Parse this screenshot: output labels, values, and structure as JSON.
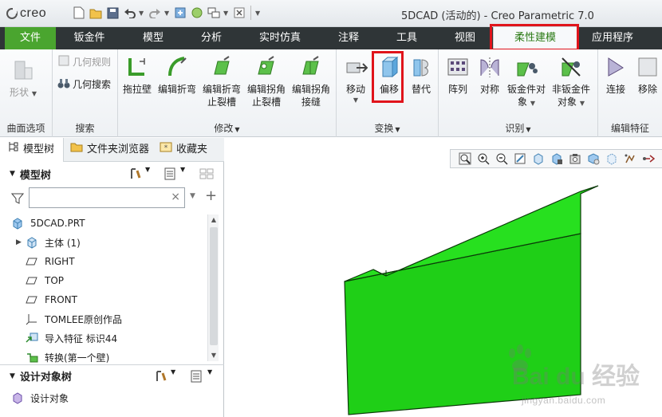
{
  "app": {
    "logo_text": "creo",
    "window_title": "5DCAD (活动的) - Creo Parametric 7.0"
  },
  "quick_access": [
    "new-icon",
    "open-icon",
    "save-icon",
    "undo-icon",
    "redo-icon",
    "regenerate-icon",
    "windows-icon",
    "close-window-icon"
  ],
  "tabs": {
    "file": "文件",
    "sheetmetal": "钣金件",
    "model": "模型",
    "analysis": "分析",
    "simulation": "实时仿真",
    "annotate": "注释",
    "tools": "工具",
    "view": "视图",
    "flexible": "柔性建模",
    "apps": "应用程序"
  },
  "ribbon": {
    "surface": {
      "label": "曲面选项",
      "shape": "形状"
    },
    "search": {
      "label": "搜索",
      "geom_rules": "几何规则",
      "geom_search": "几何搜索"
    },
    "modify": {
      "label": "修改",
      "drag_wall": "拖拉壁",
      "edit_bend": "编辑折弯",
      "edit_bend_relief": [
        "编辑折弯",
        "止裂槽"
      ],
      "edit_corner_relief": [
        "编辑拐角",
        "止裂槽"
      ],
      "edit_corner_seam": [
        "编辑拐角",
        "接缝"
      ]
    },
    "transform": {
      "label": "变换",
      "move": "移动",
      "offset": "偏移",
      "replace": "替代"
    },
    "recognize": {
      "label": "识别",
      "pattern": "阵列",
      "symmetry": "对称",
      "sheetmetal_obj": [
        "钣金件对",
        "象"
      ],
      "non_sheetmetal_obj": [
        "非钣金件",
        "对象"
      ]
    },
    "edit_feature": {
      "label": "编辑特征",
      "attach": "连接",
      "remove": "移除"
    }
  },
  "panel_tabs": {
    "model_tree": "模型树",
    "folder_browser": "文件夹浏览器",
    "favorites": "收藏夹"
  },
  "model_tree": {
    "header": "模型树",
    "search_placeholder": "",
    "items": [
      {
        "label": "5DCAD.PRT",
        "icon": "part-icon"
      },
      {
        "label": "主体 (1)",
        "icon": "body-icon"
      },
      {
        "label": "RIGHT",
        "icon": "datum-plane-icon"
      },
      {
        "label": "TOP",
        "icon": "datum-plane-icon"
      },
      {
        "label": "FRONT",
        "icon": "datum-plane-icon"
      },
      {
        "label": "TOMLEE原创作品",
        "icon": "coordinate-system-icon"
      },
      {
        "label": "导入特征 标识44",
        "icon": "import-feature-icon"
      },
      {
        "label": "转换(第一个壁)",
        "icon": "convert-icon"
      }
    ]
  },
  "design_tree": {
    "header": "设计对象树",
    "item": "设计对象"
  },
  "colors": {
    "accent": "#4aa52f",
    "highlight": "#e0141b",
    "model": "#22c41a"
  },
  "watermark": {
    "main": "Bai du 经验",
    "sub": "jingyan.baidu.com"
  }
}
